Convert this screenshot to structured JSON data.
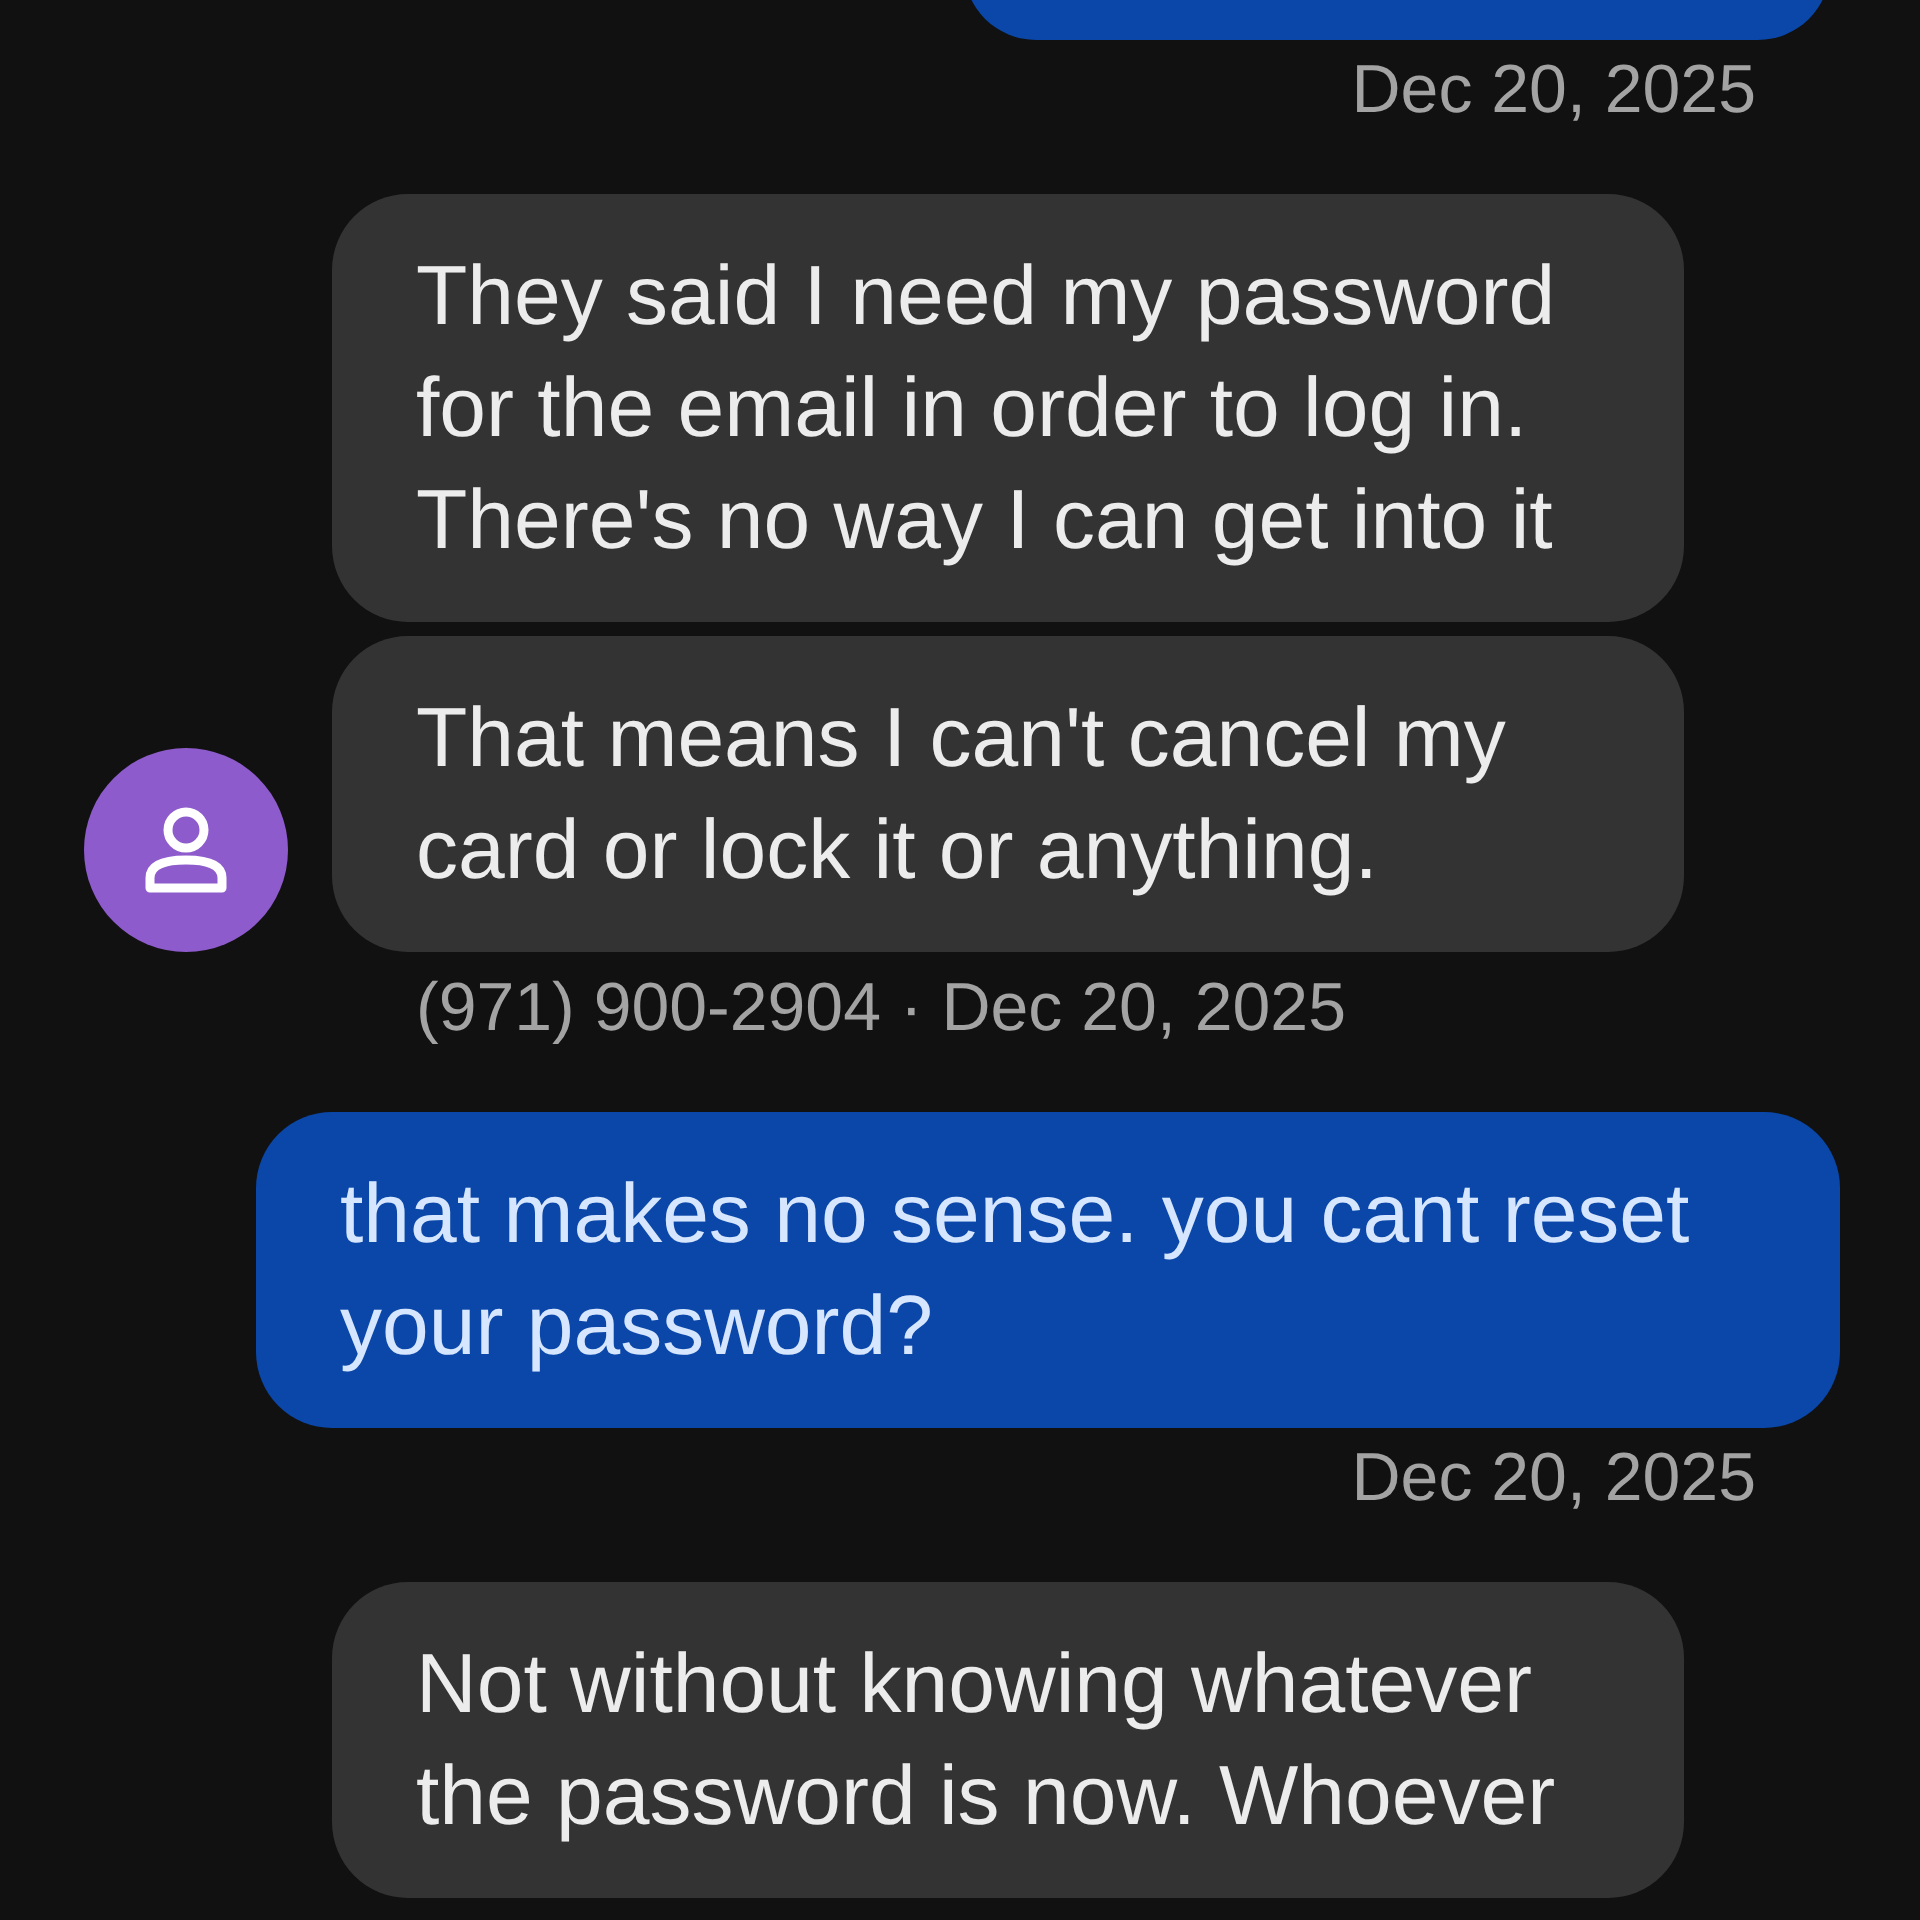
{
  "conversation": [
    {
      "kind": "timestamp",
      "text": "Dec 20, 2025"
    },
    {
      "kind": "incoming",
      "text": "They said I need my password for the email in order to log in. There's no way I can get into it",
      "avatar": false
    },
    {
      "kind": "incoming",
      "text": "That means I can't cancel my card or lock it or anything.",
      "avatar": true
    },
    {
      "kind": "meta",
      "text": "(971) 900-2904 · Dec 20, 2025"
    },
    {
      "kind": "outgoing",
      "text": "that makes no sense. you cant reset your password?"
    },
    {
      "kind": "timestamp",
      "text": "Dec 20, 2025"
    },
    {
      "kind": "incoming",
      "text": "Not without knowing whatever the password is now. Whoever",
      "avatar": false
    }
  ]
}
